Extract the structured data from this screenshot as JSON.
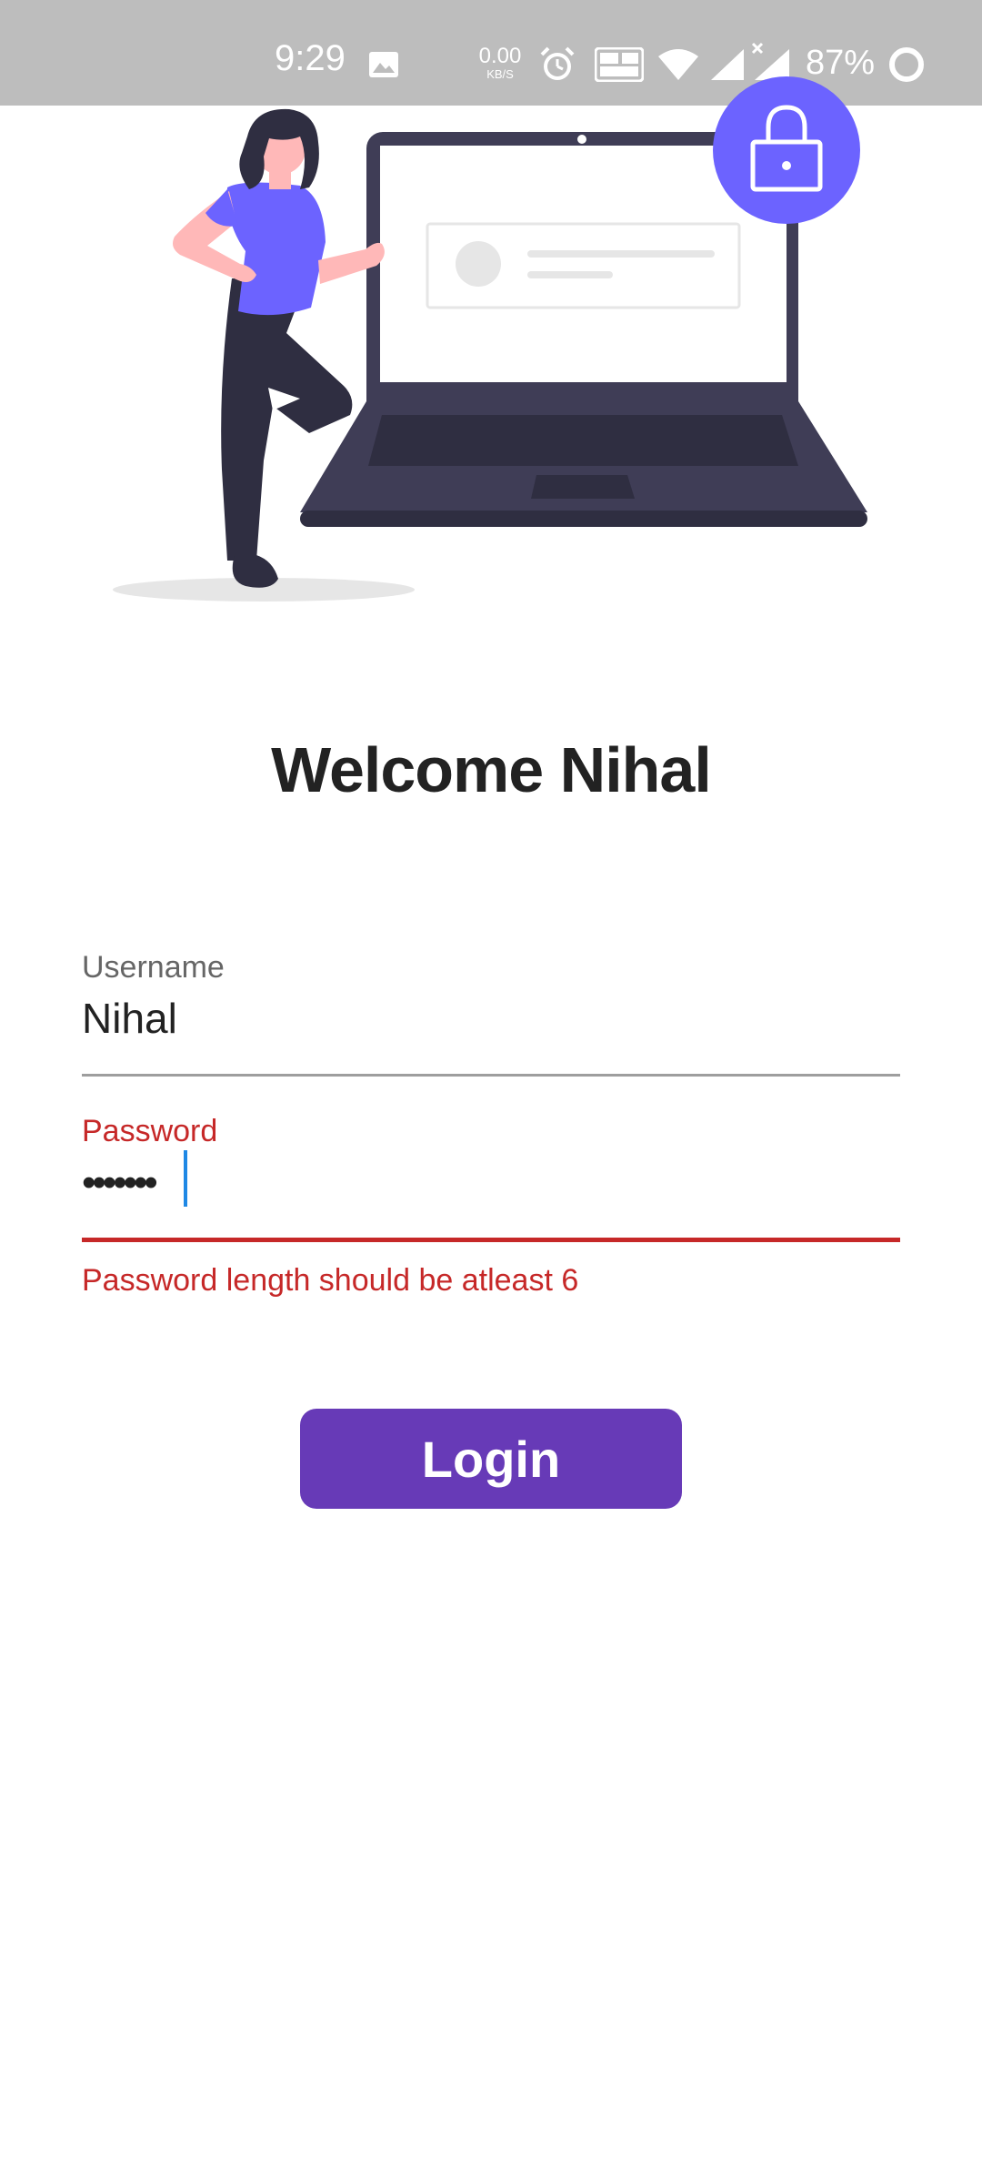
{
  "status_bar": {
    "time": "9:29",
    "net_speed_value": "0.00",
    "net_speed_unit": "KB/S",
    "battery": "87%",
    "icons": [
      "image-icon",
      "alarm-icon",
      "volte-icon",
      "wifi-icon",
      "signal-icon",
      "signal-no-data-icon",
      "battery-icon"
    ]
  },
  "illustration": {
    "name": "person-with-laptop-login-illustration",
    "colors": {
      "accent": "#6c63ff",
      "dark": "#2f2e41",
      "skin": "#ffb8b8",
      "screen": "#ffffff"
    }
  },
  "title": "Welcome Nihal",
  "username": {
    "label": "Username",
    "value": "Nihal"
  },
  "password": {
    "label": "Password",
    "masked_value": "•••••••",
    "error": "Password length should be atleast 6"
  },
  "login_button": {
    "label": "Login"
  },
  "colors": {
    "primary": "#673ab7",
    "error": "#c62828",
    "status_bar": "#bdbdbd",
    "caret": "#1e88e5"
  }
}
